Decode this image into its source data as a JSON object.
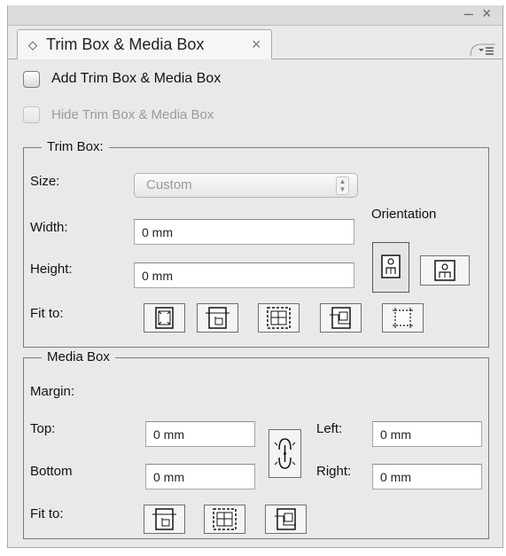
{
  "panel": {
    "tab_title": "Trim Box & Media Box",
    "tab_close": "×",
    "tab_indicator": "◇",
    "minimize": "–",
    "close": "×",
    "menu_icon": "menu-icon"
  },
  "options": {
    "add_label": "Add Trim Box & Media Box",
    "add_checked": false,
    "hide_label": "Hide Trim Box & Media Box",
    "hide_checked": false,
    "hide_disabled": true
  },
  "trim_box": {
    "legend": "Trim Box:",
    "size_label": "Size:",
    "size_value": "Custom",
    "width_label": "Width:",
    "width_value": "0 mm",
    "height_label": "Height:",
    "height_value": "0 mm",
    "orientation_label": "Orientation",
    "fit_label": "Fit to:",
    "orientation_buttons": [
      "portrait-orientation-icon",
      "landscape-orientation-icon"
    ],
    "fit_buttons": [
      "fit-artbox-icon",
      "fit-trimbox-icon",
      "fit-bleedbox-icon",
      "fit-cropbox-icon",
      "fit-mediabox-icon"
    ]
  },
  "media_box": {
    "legend": "Media Box",
    "margin_label": "Margin:",
    "top_label": "Top:",
    "top_value": "0 mm",
    "bottom_label": "Bottom",
    "bottom_value": "0 mm",
    "left_label": "Left:",
    "left_value": "0 mm",
    "right_label": "Right:",
    "right_value": "0 mm",
    "link_icon": "link-margins-icon",
    "fit_label": "Fit to:",
    "fit_buttons": [
      "fit-trimbox-icon",
      "fit-bleedbox-icon",
      "fit-cropbox-icon"
    ]
  },
  "colors": {
    "panel_bg": "#e9e9e9",
    "border": "#7a7a7a",
    "disabled_text": "#9a9a9a"
  }
}
